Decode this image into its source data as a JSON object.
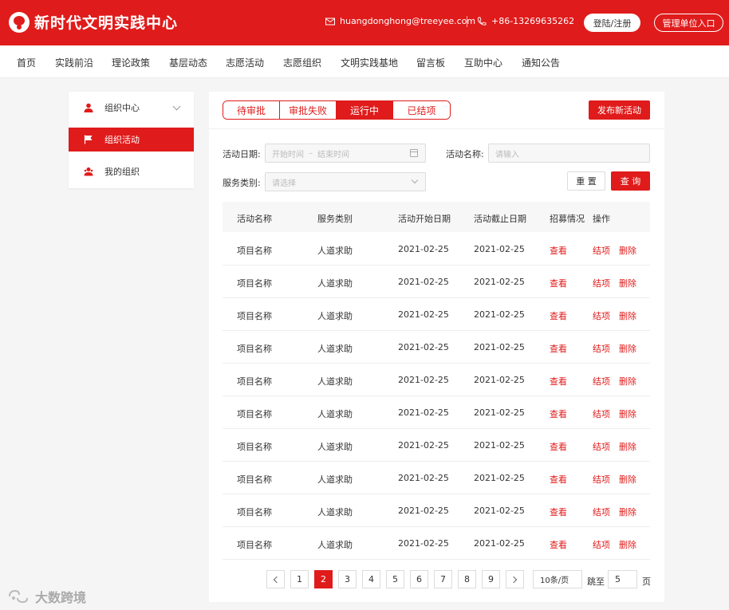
{
  "header": {
    "title": "新时代文明实践中心",
    "email": "huangdonghong@treeyee.com",
    "phone": "+86-13269635262",
    "login_label": "登陆/注册",
    "admin_label": "管理单位入口"
  },
  "nav": [
    "首页",
    "实践前沿",
    "理论政策",
    "基层动态",
    "志愿活动",
    "志愿组织",
    "文明实践基地",
    "留言板",
    "互助中心",
    "通知公告"
  ],
  "sidebar": {
    "items": [
      {
        "label": "组织中心",
        "icon": "user-icon"
      },
      {
        "label": "组织活动",
        "icon": "flag-icon"
      },
      {
        "label": "我的组织",
        "icon": "group-icon"
      }
    ]
  },
  "tabs": [
    "待审批",
    "审批失败",
    "运行中",
    "已结项"
  ],
  "publish_label": "发布新活动",
  "filters": {
    "date_label": "活动日期:",
    "date_start_placeholder": "开始时间",
    "date_sep": "–",
    "date_end_placeholder": "结束时间",
    "name_label": "活动名称:",
    "name_placeholder": "请输入",
    "category_label": "服务类别:",
    "category_placeholder": "请选择",
    "reset_label": "重 置",
    "query_label": "查 询"
  },
  "table": {
    "headers": [
      "活动名称",
      "服务类别",
      "活动开始日期",
      "活动截止日期",
      "招募情况",
      "操作"
    ],
    "rows": [
      {
        "name": "项目名称",
        "category": "人道求助",
        "start": "2021-02-25",
        "end": "2021-02-25",
        "recruit": "查看",
        "close": "结项",
        "delete": "删除"
      },
      {
        "name": "项目名称",
        "category": "人道求助",
        "start": "2021-02-25",
        "end": "2021-02-25",
        "recruit": "查看",
        "close": "结项",
        "delete": "删除"
      },
      {
        "name": "项目名称",
        "category": "人道求助",
        "start": "2021-02-25",
        "end": "2021-02-25",
        "recruit": "查看",
        "close": "结项",
        "delete": "删除"
      },
      {
        "name": "项目名称",
        "category": "人道求助",
        "start": "2021-02-25",
        "end": "2021-02-25",
        "recruit": "查看",
        "close": "结项",
        "delete": "删除"
      },
      {
        "name": "项目名称",
        "category": "人道求助",
        "start": "2021-02-25",
        "end": "2021-02-25",
        "recruit": "查看",
        "close": "结项",
        "delete": "删除"
      },
      {
        "name": "项目名称",
        "category": "人道求助",
        "start": "2021-02-25",
        "end": "2021-02-25",
        "recruit": "查看",
        "close": "结项",
        "delete": "删除"
      },
      {
        "name": "项目名称",
        "category": "人道求助",
        "start": "2021-02-25",
        "end": "2021-02-25",
        "recruit": "查看",
        "close": "结项",
        "delete": "删除"
      },
      {
        "name": "项目名称",
        "category": "人道求助",
        "start": "2021-02-25",
        "end": "2021-02-25",
        "recruit": "查看",
        "close": "结项",
        "delete": "删除"
      },
      {
        "name": "项目名称",
        "category": "人道求助",
        "start": "2021-02-25",
        "end": "2021-02-25",
        "recruit": "查看",
        "close": "结项",
        "delete": "删除"
      },
      {
        "name": "项目名称",
        "category": "人道求助",
        "start": "2021-02-25",
        "end": "2021-02-25",
        "recruit": "查看",
        "close": "结项",
        "delete": "删除"
      }
    ]
  },
  "pagination": {
    "pages": [
      "1",
      "2",
      "3",
      "4",
      "5",
      "6",
      "7",
      "8",
      "9"
    ],
    "current": "2",
    "page_size": "10条/页",
    "goto_label": "跳至",
    "goto_value": "5",
    "page_suffix": "页"
  },
  "watermark": "大数跨境",
  "colors": {
    "accent": "#e01b1b"
  }
}
